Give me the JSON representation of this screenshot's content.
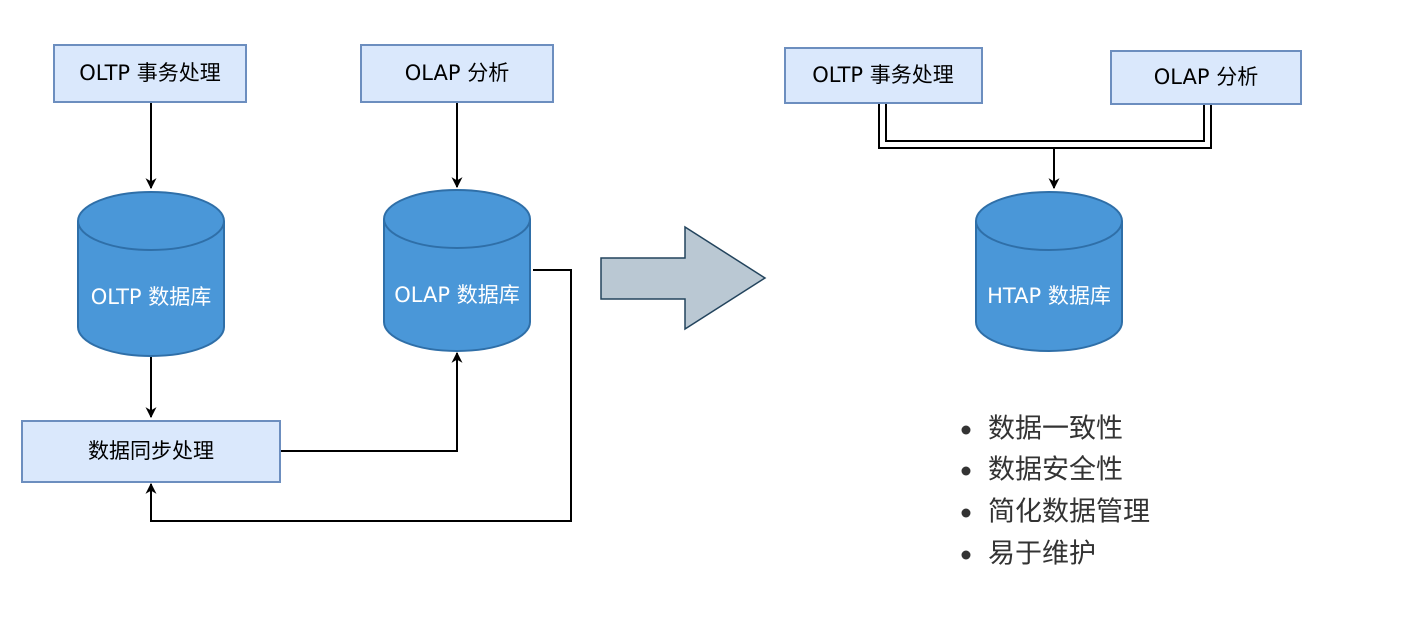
{
  "left": {
    "oltp_process": "OLTP 事务处理",
    "olap_process": "OLAP 分析",
    "oltp_db": "OLTP 数据库",
    "olap_db": "OLAP 数据库",
    "sync": "数据同步处理"
  },
  "right": {
    "oltp_process": "OLTP 事务处理",
    "olap_process": "OLAP 分析",
    "htap_db": "HTAP 数据库"
  },
  "benefits": [
    "数据一致性",
    "数据安全性",
    "简化数据管理",
    "易于维护"
  ],
  "colors": {
    "box_fill": "#dae8fc",
    "box_stroke": "#6c8ebf",
    "db_fill": "#4a97d8",
    "db_stroke": "#2f6fa8",
    "arrow_fill": "#bac8d3",
    "arrow_stroke": "#23445d"
  }
}
